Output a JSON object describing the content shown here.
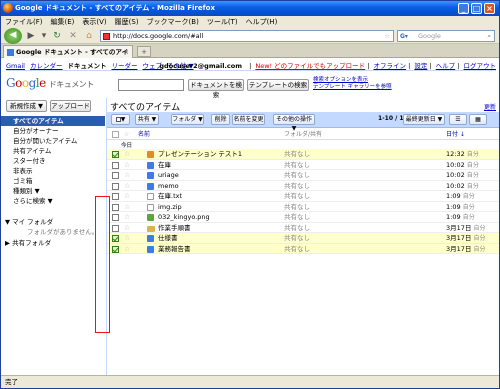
{
  "browser": {
    "window_title": "Google ドキュメント - すべてのアイテム - Mozilla Firefox",
    "menu": [
      "ファイル(F)",
      "編集(E)",
      "表示(V)",
      "履歴(S)",
      "ブックマーク(B)",
      "ツール(T)",
      "ヘルプ(H)"
    ],
    "url": "http://docs.google.com/#all",
    "search_placeholder": "Google",
    "tab_title": "Google ドキュメント - すべてのアイテム",
    "status": "完了"
  },
  "gbar": {
    "links": [
      "Gmail",
      "カレンダー",
      "ドキュメント",
      "リーダー",
      "ウェブ",
      "その他 ▼"
    ],
    "user": "gdocuser2@gmail.com",
    "new_upload": "New! どのファイルでもアップロード",
    "offline": "オフライン",
    "settings": "設定",
    "help": "ヘルプ",
    "logout": "ログアウト"
  },
  "header": {
    "logo": "Google",
    "logo_sub": "ドキュメント",
    "search_docs_button": "ドキュメントを検索",
    "search_templates_button": "テンプレートの検索",
    "search_options": "検索オプションを表示",
    "template_gallery": "テンプレート ギャラリーを参照"
  },
  "sidebar": {
    "new_button": "新規作成 ▼",
    "upload_button": "アップロード",
    "items": [
      "すべてのアイテム",
      "自分がオーナー",
      "自分が開いたアイテム",
      "共有アイテム",
      "スター付き",
      "非表示",
      "ゴミ箱",
      "種類別 ▼",
      "さらに検索 ▼"
    ],
    "my_folders": "▼ マイ フォルダ",
    "no_folders": "フォルダがありません。",
    "shared_folders": "▶ 共有フォルダ"
  },
  "main": {
    "title": "すべてのアイテム",
    "refresh": "更新",
    "toolbar": {
      "select": "▼",
      "share": "共有 ▼",
      "folder": "フォルダ ▼",
      "delete": "削除",
      "rename": "名前を変更",
      "more": "その他の操作 ▼",
      "pager": "1-10 / 10",
      "sort": "最終更新日 ▼"
    },
    "columns": {
      "name": "名前",
      "sharing": "フォルダ/共有",
      "date": "日付 ↓"
    },
    "group_today": "今日",
    "rows": [
      {
        "name": "プレゼンテーション テスト1",
        "type": "pres",
        "selected": true,
        "sharing": "共有なし",
        "date": "12:32",
        "owner": "自分"
      },
      {
        "name": "在庫",
        "type": "doc",
        "selected": false,
        "sharing": "共有なし",
        "date": "10:02",
        "owner": "自分"
      },
      {
        "name": "uriage",
        "type": "doc",
        "selected": false,
        "sharing": "共有なし",
        "date": "10:02",
        "owner": "自分"
      },
      {
        "name": "memo",
        "type": "doc",
        "selected": false,
        "sharing": "共有なし",
        "date": "10:02",
        "owner": "自分"
      },
      {
        "name": "在庫.txt",
        "type": "txt",
        "selected": false,
        "sharing": "共有なし",
        "date": "1:09",
        "owner": "自分"
      },
      {
        "name": "img.zip",
        "type": "zip",
        "selected": false,
        "sharing": "共有なし",
        "date": "1:09",
        "owner": "自分"
      },
      {
        "name": "032_kingyo.png",
        "type": "png",
        "selected": false,
        "sharing": "共有なし",
        "date": "1:09",
        "owner": "自分"
      },
      {
        "name": "作業手順書",
        "type": "folder",
        "selected": false,
        "sharing": "共有なし",
        "date": "3月17日",
        "owner": "自分"
      },
      {
        "name": "仕様書",
        "type": "doc",
        "selected": true,
        "sharing": "共有なし",
        "date": "3月17日",
        "owner": "自分"
      },
      {
        "name": "業務報告書",
        "type": "doc",
        "selected": true,
        "sharing": "共有なし",
        "date": "3月17日",
        "owner": "自分"
      }
    ]
  },
  "colors": {
    "sidebar_selected": "#2a5db0",
    "toolbar_bg": "#c3d9ff",
    "selected_row": "#ffffcc",
    "annotation": "#e8180e"
  }
}
